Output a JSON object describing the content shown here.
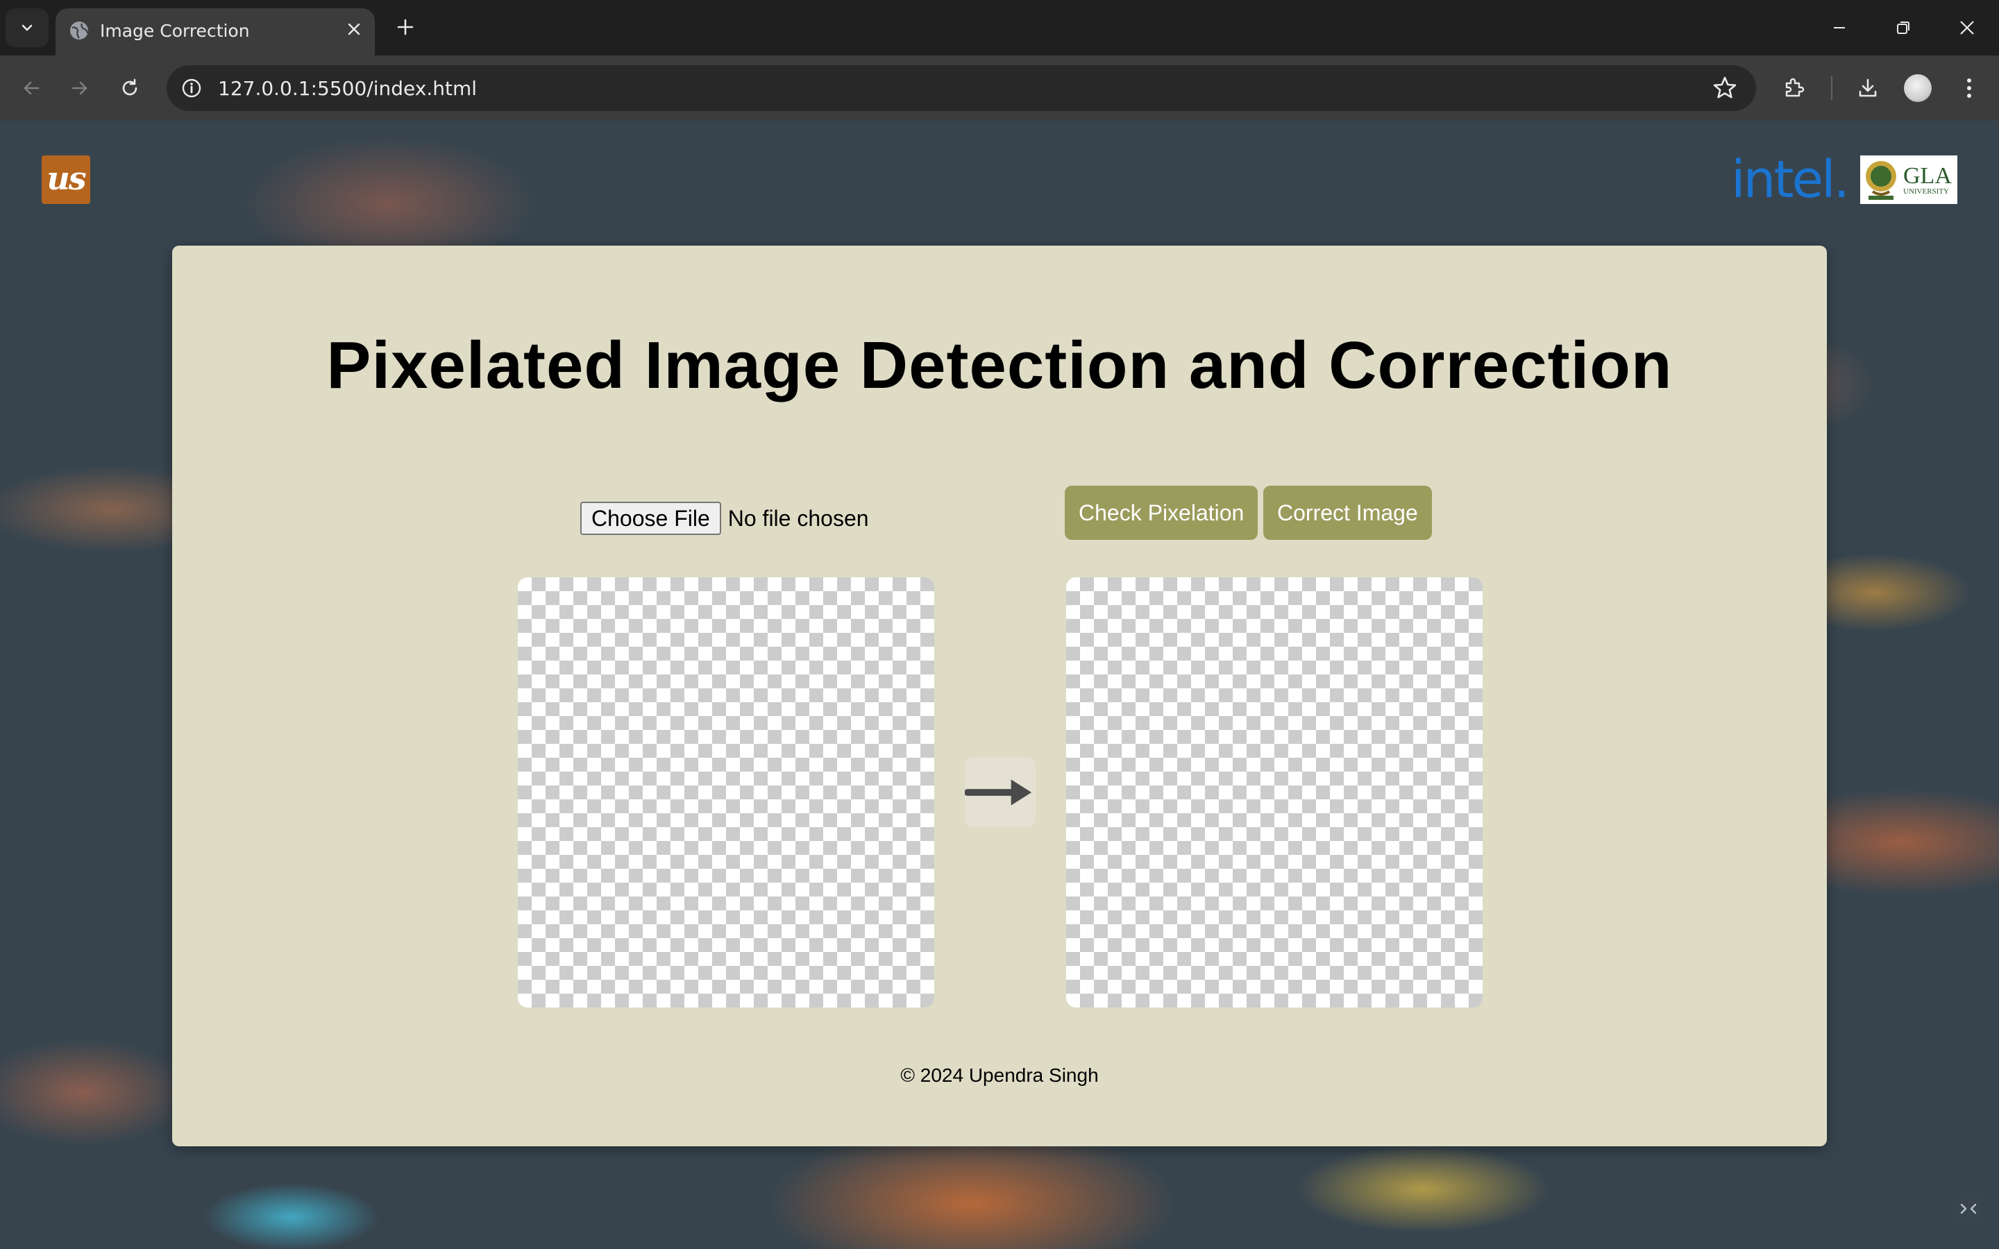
{
  "browser": {
    "tab_title": "Image Correction",
    "url": "127.0.0.1:5500/index.html"
  },
  "page": {
    "logo_left_text": "us",
    "logo_intel_text": "intel.",
    "logo_gla_text": "GLA",
    "logo_gla_subtext": "UNIVERSITY",
    "title": "Pixelated Image Detection and Correction",
    "choose_file_label": "Choose File",
    "file_status": "No file chosen",
    "check_button": "Check Pixelation",
    "correct_button": "Correct Image",
    "footer": "© 2024 Upendra Singh"
  },
  "colors": {
    "card_bg": "#dedcc5",
    "button_bg": "#9a9c5c",
    "intel_blue": "#1b74d0",
    "us_logo_bg": "#b5651d"
  }
}
